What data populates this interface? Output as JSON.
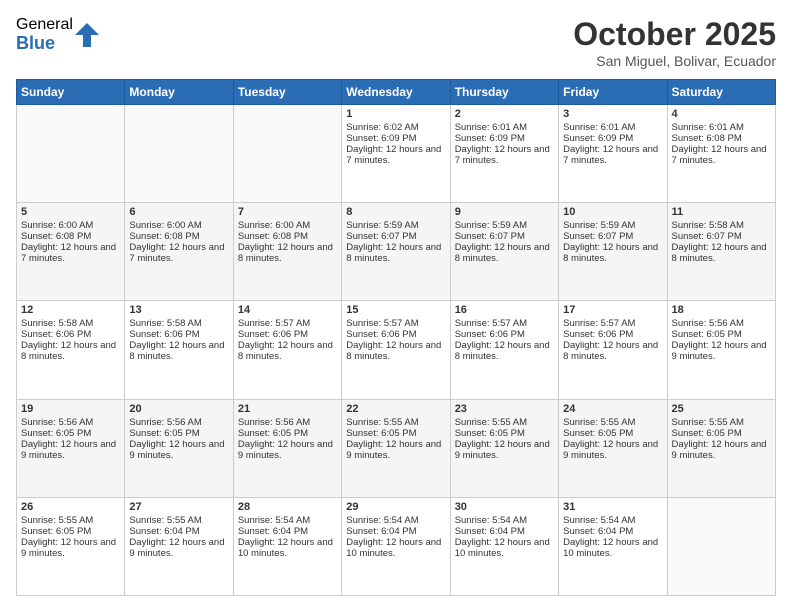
{
  "logo": {
    "general": "General",
    "blue": "Blue"
  },
  "header": {
    "month": "October 2025",
    "location": "San Miguel, Bolivar, Ecuador"
  },
  "days_of_week": [
    "Sunday",
    "Monday",
    "Tuesday",
    "Wednesday",
    "Thursday",
    "Friday",
    "Saturday"
  ],
  "weeks": [
    [
      {
        "day": "",
        "info": ""
      },
      {
        "day": "",
        "info": ""
      },
      {
        "day": "",
        "info": ""
      },
      {
        "day": "1",
        "info": "Sunrise: 6:02 AM\nSunset: 6:09 PM\nDaylight: 12 hours and 7 minutes."
      },
      {
        "day": "2",
        "info": "Sunrise: 6:01 AM\nSunset: 6:09 PM\nDaylight: 12 hours and 7 minutes."
      },
      {
        "day": "3",
        "info": "Sunrise: 6:01 AM\nSunset: 6:09 PM\nDaylight: 12 hours and 7 minutes."
      },
      {
        "day": "4",
        "info": "Sunrise: 6:01 AM\nSunset: 6:08 PM\nDaylight: 12 hours and 7 minutes."
      }
    ],
    [
      {
        "day": "5",
        "info": "Sunrise: 6:00 AM\nSunset: 6:08 PM\nDaylight: 12 hours and 7 minutes."
      },
      {
        "day": "6",
        "info": "Sunrise: 6:00 AM\nSunset: 6:08 PM\nDaylight: 12 hours and 7 minutes."
      },
      {
        "day": "7",
        "info": "Sunrise: 6:00 AM\nSunset: 6:08 PM\nDaylight: 12 hours and 8 minutes."
      },
      {
        "day": "8",
        "info": "Sunrise: 5:59 AM\nSunset: 6:07 PM\nDaylight: 12 hours and 8 minutes."
      },
      {
        "day": "9",
        "info": "Sunrise: 5:59 AM\nSunset: 6:07 PM\nDaylight: 12 hours and 8 minutes."
      },
      {
        "day": "10",
        "info": "Sunrise: 5:59 AM\nSunset: 6:07 PM\nDaylight: 12 hours and 8 minutes."
      },
      {
        "day": "11",
        "info": "Sunrise: 5:58 AM\nSunset: 6:07 PM\nDaylight: 12 hours and 8 minutes."
      }
    ],
    [
      {
        "day": "12",
        "info": "Sunrise: 5:58 AM\nSunset: 6:06 PM\nDaylight: 12 hours and 8 minutes."
      },
      {
        "day": "13",
        "info": "Sunrise: 5:58 AM\nSunset: 6:06 PM\nDaylight: 12 hours and 8 minutes."
      },
      {
        "day": "14",
        "info": "Sunrise: 5:57 AM\nSunset: 6:06 PM\nDaylight: 12 hours and 8 minutes."
      },
      {
        "day": "15",
        "info": "Sunrise: 5:57 AM\nSunset: 6:06 PM\nDaylight: 12 hours and 8 minutes."
      },
      {
        "day": "16",
        "info": "Sunrise: 5:57 AM\nSunset: 6:06 PM\nDaylight: 12 hours and 8 minutes."
      },
      {
        "day": "17",
        "info": "Sunrise: 5:57 AM\nSunset: 6:06 PM\nDaylight: 12 hours and 8 minutes."
      },
      {
        "day": "18",
        "info": "Sunrise: 5:56 AM\nSunset: 6:05 PM\nDaylight: 12 hours and 9 minutes."
      }
    ],
    [
      {
        "day": "19",
        "info": "Sunrise: 5:56 AM\nSunset: 6:05 PM\nDaylight: 12 hours and 9 minutes."
      },
      {
        "day": "20",
        "info": "Sunrise: 5:56 AM\nSunset: 6:05 PM\nDaylight: 12 hours and 9 minutes."
      },
      {
        "day": "21",
        "info": "Sunrise: 5:56 AM\nSunset: 6:05 PM\nDaylight: 12 hours and 9 minutes."
      },
      {
        "day": "22",
        "info": "Sunrise: 5:55 AM\nSunset: 6:05 PM\nDaylight: 12 hours and 9 minutes."
      },
      {
        "day": "23",
        "info": "Sunrise: 5:55 AM\nSunset: 6:05 PM\nDaylight: 12 hours and 9 minutes."
      },
      {
        "day": "24",
        "info": "Sunrise: 5:55 AM\nSunset: 6:05 PM\nDaylight: 12 hours and 9 minutes."
      },
      {
        "day": "25",
        "info": "Sunrise: 5:55 AM\nSunset: 6:05 PM\nDaylight: 12 hours and 9 minutes."
      }
    ],
    [
      {
        "day": "26",
        "info": "Sunrise: 5:55 AM\nSunset: 6:05 PM\nDaylight: 12 hours and 9 minutes."
      },
      {
        "day": "27",
        "info": "Sunrise: 5:55 AM\nSunset: 6:04 PM\nDaylight: 12 hours and 9 minutes."
      },
      {
        "day": "28",
        "info": "Sunrise: 5:54 AM\nSunset: 6:04 PM\nDaylight: 12 hours and 10 minutes."
      },
      {
        "day": "29",
        "info": "Sunrise: 5:54 AM\nSunset: 6:04 PM\nDaylight: 12 hours and 10 minutes."
      },
      {
        "day": "30",
        "info": "Sunrise: 5:54 AM\nSunset: 6:04 PM\nDaylight: 12 hours and 10 minutes."
      },
      {
        "day": "31",
        "info": "Sunrise: 5:54 AM\nSunset: 6:04 PM\nDaylight: 12 hours and 10 minutes."
      },
      {
        "day": "",
        "info": ""
      }
    ]
  ]
}
